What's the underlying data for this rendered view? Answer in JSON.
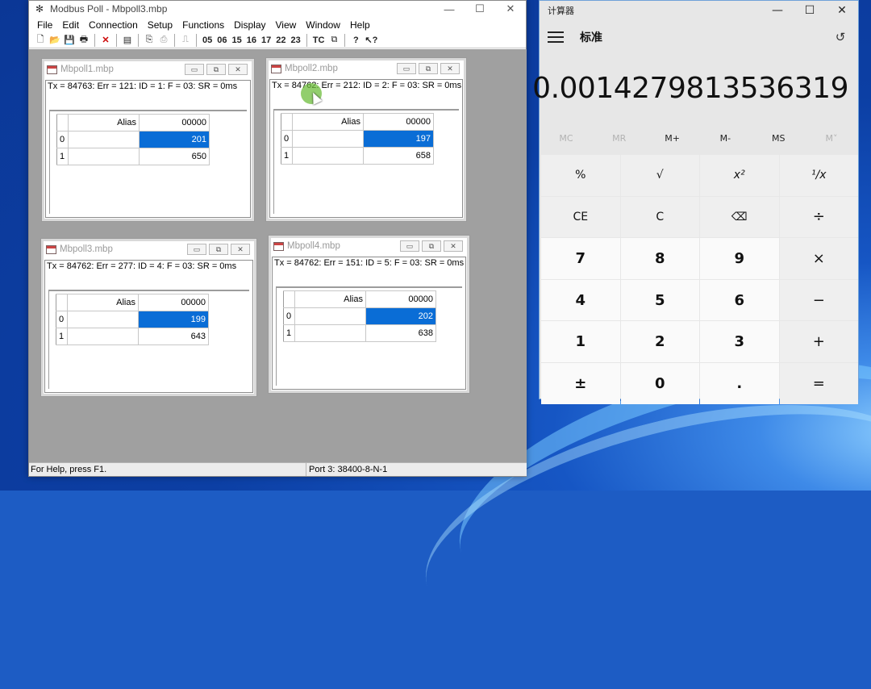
{
  "modbus": {
    "title": "Modbus Poll - Mbpoll3.mbp",
    "menu": [
      "File",
      "Edit",
      "Connection",
      "Setup",
      "Functions",
      "Display",
      "View",
      "Window",
      "Help"
    ],
    "toolbar_text": [
      "05",
      "06",
      "15",
      "16",
      "17",
      "22",
      "23",
      "TC"
    ],
    "status_help": "For Help, press F1.",
    "status_port": "Port 3: 38400-8-N-1",
    "column_alias": "Alias",
    "column_value": "00000",
    "windows": [
      {
        "title": "Mbpoll1.mbp",
        "status": "Tx = 84763: Err = 121: ID = 1: F = 03: SR = 0ms",
        "rows": [
          {
            "index": "0",
            "value": "201"
          },
          {
            "index": "1",
            "value": "650"
          }
        ]
      },
      {
        "title": "Mbpoll2.mbp",
        "status": "Tx = 84762: Err = 212: ID = 2: F = 03: SR = 0ms",
        "rows": [
          {
            "index": "0",
            "value": "197"
          },
          {
            "index": "1",
            "value": "658"
          }
        ]
      },
      {
        "title": "Mbpoll3.mbp",
        "status": "Tx = 84762: Err = 277: ID = 4: F = 03: SR = 0ms",
        "rows": [
          {
            "index": "0",
            "value": "199"
          },
          {
            "index": "1",
            "value": "643"
          }
        ]
      },
      {
        "title": "Mbpoll4.mbp",
        "status": "Tx = 84762: Err = 151: ID = 5: F = 03: SR = 0ms",
        "rows": [
          {
            "index": "0",
            "value": "202"
          },
          {
            "index": "1",
            "value": "638"
          }
        ]
      }
    ]
  },
  "calculator": {
    "title": "计算器",
    "mode": "标准",
    "display": "0.0014279813536319",
    "memory": [
      "MC",
      "MR",
      "M+",
      "M-",
      "MS",
      "M˅"
    ],
    "keys": [
      [
        "%",
        "√",
        "x²",
        "¹/x"
      ],
      [
        "CE",
        "C",
        "⌫",
        "÷"
      ],
      [
        "7",
        "8",
        "9",
        "×"
      ],
      [
        "4",
        "5",
        "6",
        "−"
      ],
      [
        "1",
        "2",
        "3",
        "+"
      ],
      [
        "±",
        "0",
        ".",
        "="
      ]
    ]
  }
}
